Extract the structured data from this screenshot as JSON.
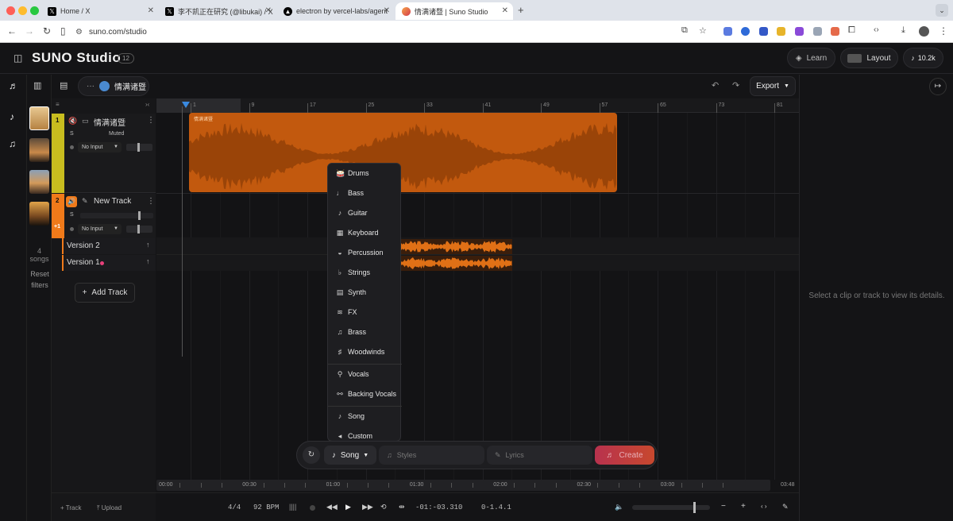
{
  "browser": {
    "tabs": [
      {
        "title": "Home / X",
        "icon": "x-logo"
      },
      {
        "title": "李不凯正在研究 (@libukai) / X",
        "icon": "x-logo"
      },
      {
        "title": "electron by vercel-labs/agent",
        "icon": "vercel-logo"
      },
      {
        "title": "情满诸暨 | Suno Studio",
        "icon": "suno-logo",
        "active": true
      }
    ],
    "new_tab": "+",
    "url": "suno.com/studio"
  },
  "app": {
    "logo": "SUNO Studio",
    "version_badge": "12",
    "learn_label": "Learn",
    "layout_label": "Layout",
    "credits": "10.2k",
    "project_name": "情满诸暨",
    "more": "···",
    "export_label": "Export"
  },
  "library": {
    "count": "4 songs",
    "reset_filters": "Reset filters"
  },
  "tracks": [
    {
      "number": "1",
      "name": "情满诸暨",
      "solo": "S",
      "status": "Muted",
      "input": "No Input",
      "color": "#c8bd1f"
    },
    {
      "number": "2",
      "name": "New Track",
      "solo": "S",
      "input": "No Input",
      "color": "#f07a1a",
      "extra": "+1"
    }
  ],
  "versions": [
    {
      "label": "Version 2"
    },
    {
      "label": "Version 1"
    }
  ],
  "add_track": "Add Track",
  "ruler_marks": [
    "1",
    "9",
    "17",
    "25",
    "33",
    "41",
    "49",
    "57",
    "65",
    "73",
    "81"
  ],
  "clip_label": "情满诸暨",
  "instrument_menu": {
    "groups": [
      [
        {
          "label": "Drums",
          "icon": "drum-icon"
        },
        {
          "label": "Bass",
          "icon": "bass-icon"
        },
        {
          "label": "Guitar",
          "icon": "guitar-icon"
        },
        {
          "label": "Keyboard",
          "icon": "keyboard-icon"
        },
        {
          "label": "Percussion",
          "icon": "percussion-icon"
        },
        {
          "label": "Strings",
          "icon": "strings-icon"
        },
        {
          "label": "Synth",
          "icon": "synth-icon"
        },
        {
          "label": "FX",
          "icon": "fx-icon"
        },
        {
          "label": "Brass",
          "icon": "brass-icon"
        },
        {
          "label": "Woodwinds",
          "icon": "woodwinds-icon"
        }
      ],
      [
        {
          "label": "Vocals",
          "icon": "mic-icon"
        },
        {
          "label": "Backing Vocals",
          "icon": "backing-vocals-icon"
        }
      ],
      [
        {
          "label": "Song",
          "icon": "note-icon"
        },
        {
          "label": "Custom",
          "icon": "custom-icon"
        }
      ]
    ]
  },
  "create_bar": {
    "mode": "Song",
    "styles_placeholder": "Styles",
    "lyrics_placeholder": "Lyrics",
    "create_label": "Create"
  },
  "time_ruler": [
    "00:00",
    "00:30",
    "01:00",
    "01:30",
    "02:00",
    "02:30",
    "03:00"
  ],
  "duration": "03:48",
  "transport": {
    "add_track": "Track",
    "upload": "Upload",
    "time_signature": "4/4",
    "bpm": "92 BPM",
    "position": "-01:-03.310",
    "bars": "0-1.4.1"
  },
  "details_hint": "Select a clip or track to view its details.",
  "colors": {
    "clip_orange": "#c2590e",
    "track1": "#c8bd1f",
    "track2": "#f07a1a",
    "create": "#c0354a"
  }
}
